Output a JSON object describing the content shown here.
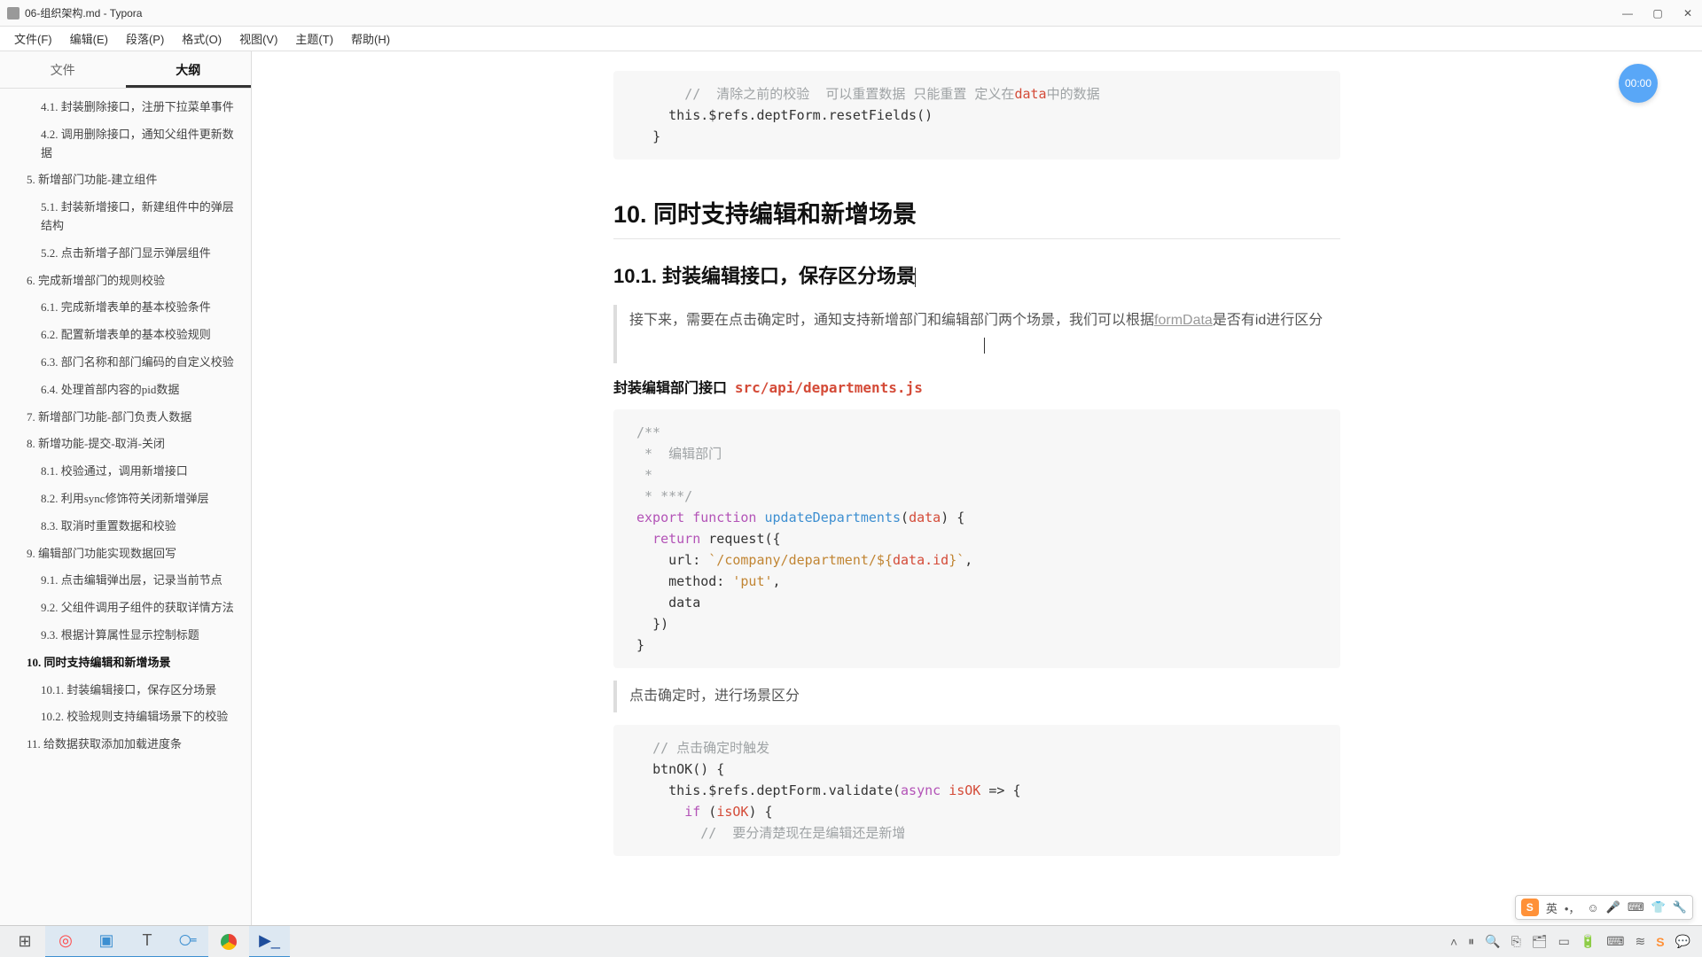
{
  "window": {
    "title": "06-组织架构.md - Typora"
  },
  "menu": {
    "file": "文件(F)",
    "edit": "编辑(E)",
    "paragraph": "段落(P)",
    "format": "格式(O)",
    "view": "视图(V)",
    "theme": "主题(T)",
    "help": "帮助(H)"
  },
  "sidebar": {
    "tab_file": "文件",
    "tab_outline": "大纲",
    "items": [
      {
        "level": 2,
        "label": "4.1. 封装删除接口，注册下拉菜单事件"
      },
      {
        "level": 2,
        "label": "4.2. 调用删除接口，通知父组件更新数据"
      },
      {
        "level": 1,
        "label": "5. 新增部门功能-建立组件"
      },
      {
        "level": 2,
        "label": "5.1. 封装新增接口，新建组件中的弹层结构"
      },
      {
        "level": 2,
        "label": "5.2. 点击新增子部门显示弹层组件"
      },
      {
        "level": 1,
        "label": "6. 完成新增部门的规则校验"
      },
      {
        "level": 2,
        "label": "6.1. 完成新增表单的基本校验条件"
      },
      {
        "level": 2,
        "label": "6.2. 配置新增表单的基本校验规则"
      },
      {
        "level": 2,
        "label": "6.3. 部门名称和部门编码的自定义校验"
      },
      {
        "level": 2,
        "label": "6.4. 处理首部内容的pid数据"
      },
      {
        "level": 1,
        "label": "7. 新增部门功能-部门负责人数据"
      },
      {
        "level": 1,
        "label": "8. 新增功能-提交-取消-关闭"
      },
      {
        "level": 2,
        "label": "8.1. 校验通过，调用新增接口"
      },
      {
        "level": 2,
        "label": "8.2. 利用sync修饰符关闭新增弹层"
      },
      {
        "level": 2,
        "label": "8.3. 取消时重置数据和校验"
      },
      {
        "level": 1,
        "label": "9. 编辑部门功能实现数据回写"
      },
      {
        "level": 2,
        "label": "9.1. 点击编辑弹出层，记录当前节点"
      },
      {
        "level": 2,
        "label": "9.2. 父组件调用子组件的获取详情方法"
      },
      {
        "level": 2,
        "label": "9.3. 根据计算属性显示控制标题"
      },
      {
        "level": 1,
        "label": "10. 同时支持编辑和新增场景",
        "highlight": true
      },
      {
        "level": 2,
        "label": "10.1. 封装编辑接口，保存区分场景"
      },
      {
        "level": 2,
        "label": "10.2. 校验规则支持编辑场景下的校验"
      },
      {
        "level": 1,
        "label": "11. 给数据获取添加加载进度条"
      }
    ]
  },
  "timer": "00:00",
  "content": {
    "code1_comment": "//  清除之前的校验  可以重置数据 只能重置 定义在",
    "code1_comment_hl": "data",
    "code1_comment_suffix": "中的数据",
    "code1_line2": "this.$refs.deptForm.resetFields()",
    "code1_line3": "}",
    "h1": "10. 同时支持编辑和新增场景",
    "h2": "10.1. 封装编辑接口，保存区分场景",
    "quote1_pre": "接下来，需要在点击确定时，通知支持新增部门和编辑部门两个场景，我们可以根据",
    "quote1_link": "formData",
    "quote1_post": "是否有id进行区分",
    "para_bold": "封装编辑部门接口",
    "para_path": "src/api/departments.js",
    "code2_l1": "/**",
    "code2_l2": " *  编辑部门",
    "code2_l3": " *",
    "code2_l4": " * ***/",
    "code2_export": "export",
    "code2_function": "function",
    "code2_fn": "updateDepartments",
    "code2_param": "data",
    "code2_return": "return",
    "code2_request": "request({",
    "code2_url_label": "url:",
    "code2_url_prefix": "`/company/department/${",
    "code2_url_var": "data.id",
    "code2_url_suffix": "}`",
    "code2_method_label": "method:",
    "code2_method": "'put'",
    "code2_data": "data",
    "code2_close1": "})",
    "code2_close2": "}",
    "quote2": "点击确定时，进行场景区分",
    "code3_comment1": "// 点击确定时触发",
    "code3_btn": "btnOK() {",
    "code3_validate_pre": "this.$refs.deptForm.validate(",
    "code3_async": "async",
    "code3_isok": "isOK",
    "code3_arrow": " => {",
    "code3_if": "if",
    "code3_if_cond": "(",
    "code3_if_var": "isOK",
    "code3_if_close": ") {",
    "code3_comment2": "//  要分清楚现在是编辑还是新增"
  },
  "ime": {
    "lang": "英",
    "icons_count": 7
  }
}
